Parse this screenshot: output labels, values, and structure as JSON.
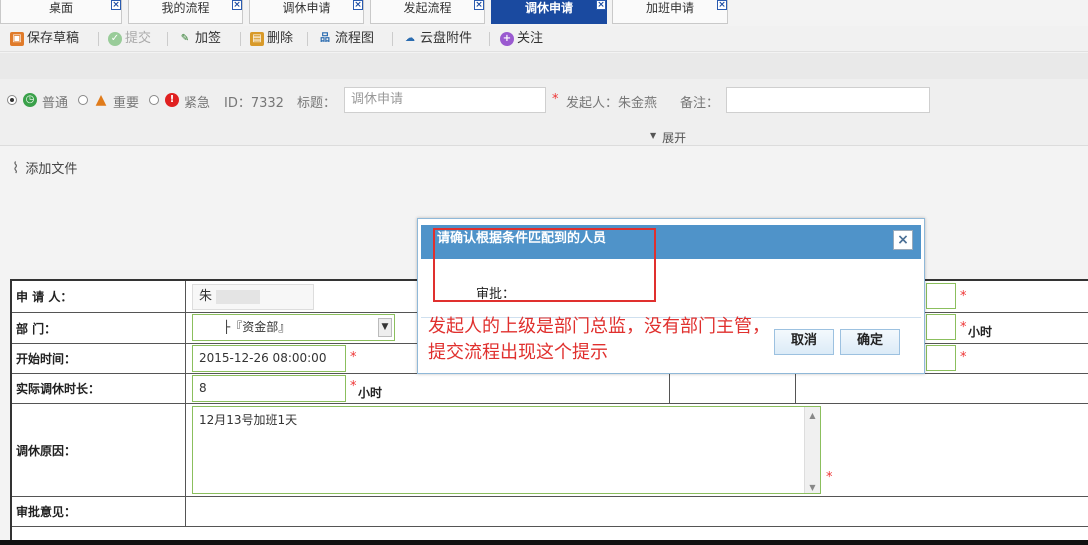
{
  "tabs": [
    {
      "label": "桌面",
      "active": false
    },
    {
      "label": "我的流程",
      "active": false
    },
    {
      "label": "调休申请",
      "active": false
    },
    {
      "label": "发起流程",
      "active": false
    },
    {
      "label": "调休申请",
      "active": true
    },
    {
      "label": "加班申请",
      "active": false
    }
  ],
  "toolbar": {
    "save_draft": "保存草稿",
    "submit": "提交",
    "add_sign": "加签",
    "delete": "删除",
    "flowchart": "流程图",
    "cloud_attach": "云盘附件",
    "follow": "关注"
  },
  "priority": {
    "normal": "普通",
    "important": "重要",
    "urgent": "紧急"
  },
  "meta": {
    "id_label": "ID：",
    "id_value": "7332",
    "title_label": "标题：",
    "title_placeholder": "调休申请",
    "initiator_label": "发起人：",
    "initiator_value": "朱金燕",
    "remark_label": "备注：",
    "expand": "展开"
  },
  "attach": {
    "label": "添加文件"
  },
  "form": {
    "applicant_label": "申 请 人：",
    "applicant_value": "朱",
    "dept_label": "部    门：",
    "dept_value": "├『资金部』",
    "start_label": "开始时间：",
    "start_value": "2015-12-26 08:00:00",
    "duration_label": "实际调休时长：",
    "duration_value": "8",
    "duration_unit": "小时",
    "dept_unit": "小时",
    "reason_label": "调休原因：",
    "reason_value": "12月13号加班1天",
    "approval_label": "审批意见："
  },
  "dialog": {
    "title": "请确认根据条件匹配到的人员",
    "approve_label": "审批：",
    "cancel": "取消",
    "confirm": "确定"
  },
  "annotation": "发起人的上级是部门总监，没有部门主管，提交流程出现这个提示",
  "colors": {
    "accent": "#1a4aa0",
    "dialog_header": "#4f93c9",
    "annotation": "#e0302e",
    "input_border": "#8bbf5d"
  }
}
